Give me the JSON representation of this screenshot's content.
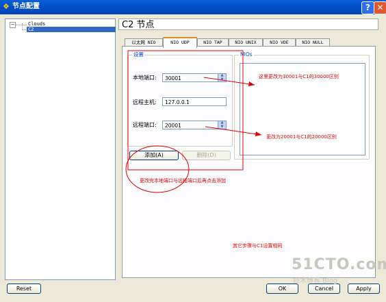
{
  "window": {
    "title": "节点配置",
    "help_label": "?",
    "close_label": "✕"
  },
  "tree": {
    "toggle": "−",
    "items": [
      {
        "label": "Clouds"
      },
      {
        "label": "C2"
      }
    ]
  },
  "main": {
    "title": "C2 节点"
  },
  "tabs": [
    {
      "label": "以太网 NIO"
    },
    {
      "label": "NIO UDP"
    },
    {
      "label": "NIO TAP"
    },
    {
      "label": "NIO UNIX"
    },
    {
      "label": "NIO VDE"
    },
    {
      "label": "NIO NULL"
    }
  ],
  "settings": {
    "group_label": "设置",
    "local_port_label": "本地端口:",
    "local_port_value": "30001",
    "remote_host_label": "远程主机:",
    "remote_host_value": "127.0.0.1",
    "remote_port_label": "远程端口:",
    "remote_port_value": "20001",
    "add_button": "添加(A)",
    "delete_button": "删除(D)"
  },
  "nios": {
    "group_label": "NIOs"
  },
  "annotations": {
    "note1": "这里更改为30001与C1的30000区别",
    "note2": "更改为20001与C1的20000区别",
    "note3": "更改完本地端口与远程端口后再点击添加",
    "note4": "其它步骤与C1设置相同"
  },
  "footer": {
    "reset": "Reset",
    "ok": "OK",
    "cancel": "Cancel",
    "apply": "Apply"
  },
  "watermark": {
    "line1": "51CTO.com",
    "line2": "技术博客 Blog"
  },
  "colors": {
    "annotation": "#e00000",
    "titlebar": "#0350c8",
    "selection": "#316ac5"
  }
}
